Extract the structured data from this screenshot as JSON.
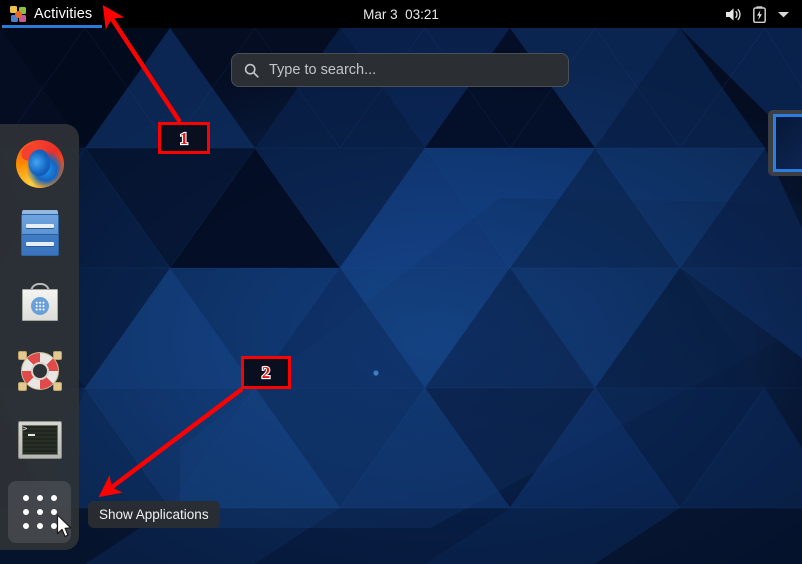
{
  "topbar": {
    "activities_label": "Activities",
    "activities_icon": "gnome-pinwheel-icon",
    "clock": "Mar 3  03:21",
    "status_icons": [
      "volume-speaker-icon",
      "battery-charging-icon",
      "chevron-down-icon"
    ]
  },
  "search": {
    "placeholder": "Type to search...",
    "icon": "search-icon"
  },
  "dash": {
    "items": [
      {
        "name": "firefox",
        "label": "Firefox Web Browser",
        "icon": "firefox-icon"
      },
      {
        "name": "files",
        "label": "Files",
        "icon": "file-cabinet-icon"
      },
      {
        "name": "software",
        "label": "Software",
        "icon": "shopping-bag-icon"
      },
      {
        "name": "help",
        "label": "Help",
        "icon": "lifebuoy-icon"
      },
      {
        "name": "terminal",
        "label": "Terminal",
        "icon": "terminal-icon"
      },
      {
        "name": "show-applications",
        "label": "Show Applications",
        "icon": "app-grid-icon"
      }
    ]
  },
  "tooltip": {
    "text": "Show Applications"
  },
  "annotations": {
    "markers": [
      {
        "id": 1,
        "label": "1",
        "points_to": "activities-button"
      },
      {
        "id": 2,
        "label": "2",
        "points_to": "show-applications-button"
      }
    ],
    "color": "#ff0000"
  },
  "window_thumbnail": {
    "name": "window-preview",
    "border_color": "#2b7de0"
  },
  "colors": {
    "topbar_bg": "#000000",
    "dash_bg": "#2e3236",
    "accent_blue": "#2a7bd6",
    "wallpaper_bg": "#0a1733",
    "annotation_red": "#ff0000"
  }
}
